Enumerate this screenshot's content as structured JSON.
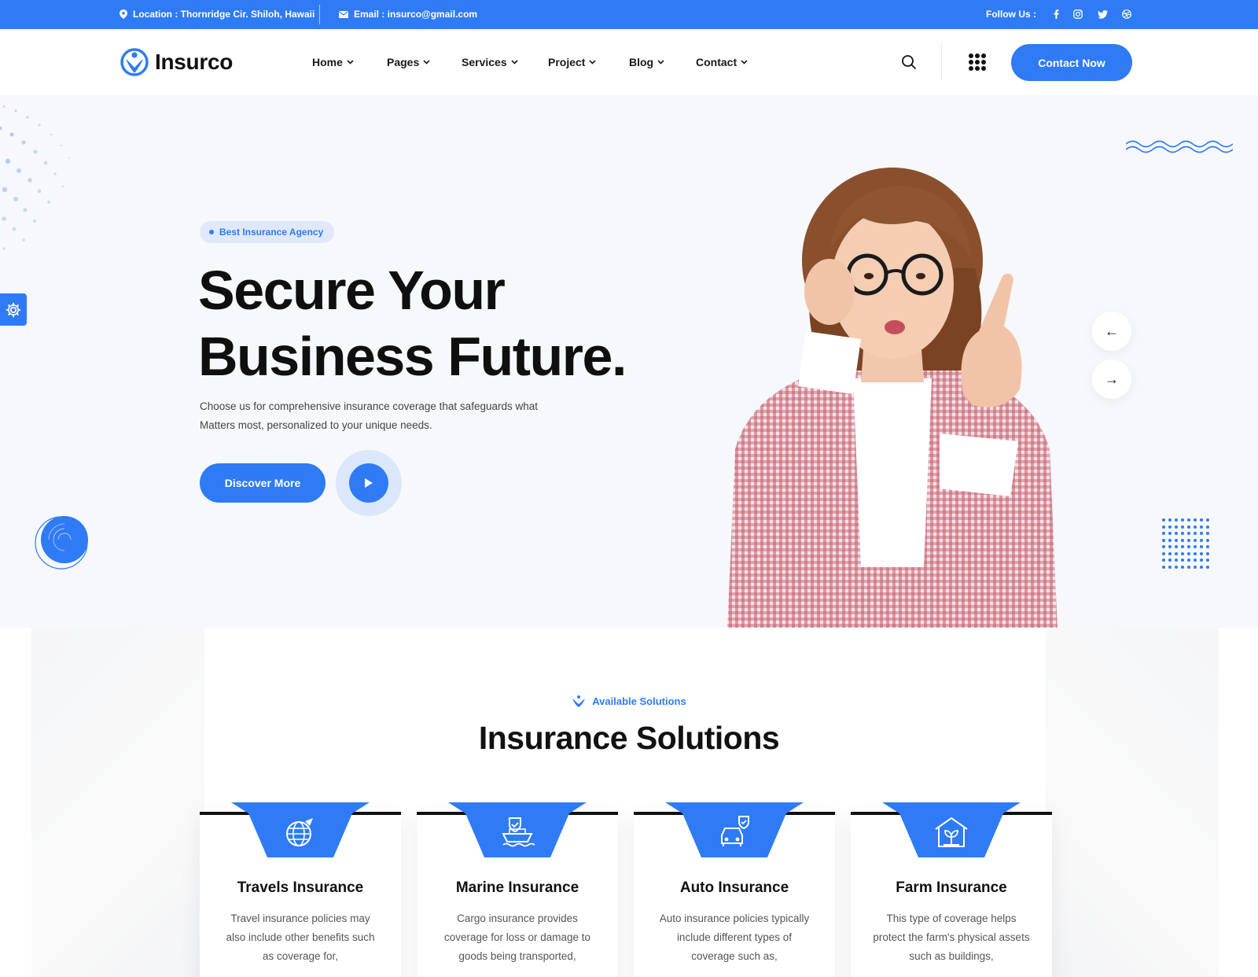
{
  "topbar": {
    "location": "Location : Thornridge Cir. Shiloh, Hawaii",
    "email": "Email : insurco@gmail.com",
    "follow_label": "Follow Us :",
    "social": [
      "facebook-icon",
      "instagram-icon",
      "twitter-icon",
      "dribbble-icon"
    ]
  },
  "header": {
    "logo_text": "Insurco",
    "nav": [
      {
        "label": "Home"
      },
      {
        "label": "Pages"
      },
      {
        "label": "Services"
      },
      {
        "label": "Project"
      },
      {
        "label": "Blog"
      },
      {
        "label": "Contact"
      }
    ],
    "contact_label": "Contact Now"
  },
  "hero": {
    "badge": "Best Insurance Agency",
    "title_line1": "Secure Your",
    "title_line2": "Business Future.",
    "description": "Choose us for comprehensive insurance coverage that safeguards what Matters most, personalized to your unique needs.",
    "cta_label": "Discover More",
    "prev_arrow": "←",
    "next_arrow": "→"
  },
  "solutions": {
    "eyebrow": "Available Solutions",
    "title": "Insurance Solutions",
    "cards": [
      {
        "title": "Travels Insurance",
        "description": "Travel insurance policies may also include other benefits such as coverage for,",
        "icon": "globe-plane-icon"
      },
      {
        "title": "Marine Insurance",
        "description": "Cargo insurance provides coverage for loss or damage to goods being transported,",
        "icon": "ship-shield-icon"
      },
      {
        "title": "Auto Insurance",
        "description": "Auto insurance policies typically include different types of coverage such as,",
        "icon": "car-shield-icon"
      },
      {
        "title": "Farm Insurance",
        "description": "This type of coverage helps protect the farm's physical assets such as buildings,",
        "icon": "house-plant-icon"
      }
    ]
  },
  "colors": {
    "primary": "#2f7bf5",
    "dark": "#111111",
    "hero_bg": "#f6f8fb"
  }
}
